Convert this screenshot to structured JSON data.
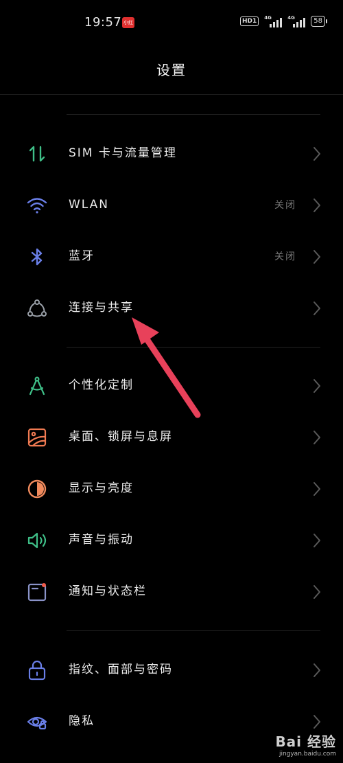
{
  "status_bar": {
    "time": "19:57",
    "app_badge": "小红书",
    "hd": "HD1",
    "signal1": "4G",
    "signal2": "4G",
    "battery": "58"
  },
  "header": {
    "title": "设置"
  },
  "items": [
    {
      "label": "SIM 卡与流量管理",
      "value": "",
      "icon": "sim-data-icon",
      "color": "#3fbf88"
    },
    {
      "label": "WLAN",
      "value": "关闭",
      "icon": "wifi-icon",
      "color": "#6a7fe8"
    },
    {
      "label": "蓝牙",
      "value": "关闭",
      "icon": "bluetooth-icon",
      "color": "#6a7fe8"
    },
    {
      "label": "连接与共享",
      "value": "",
      "icon": "connection-share-icon",
      "color": "#9aa0a8"
    },
    {
      "label": "个性化定制",
      "value": "",
      "icon": "compass-icon",
      "color": "#3fbf88"
    },
    {
      "label": "桌面、锁屏与息屏",
      "value": "",
      "icon": "wallpaper-icon",
      "color": "#f07a52"
    },
    {
      "label": "显示与亮度",
      "value": "",
      "icon": "brightness-icon",
      "color": "#f08a5d"
    },
    {
      "label": "声音与振动",
      "value": "",
      "icon": "speaker-icon",
      "color": "#3fbf88"
    },
    {
      "label": "通知与状态栏",
      "value": "",
      "icon": "notification-icon",
      "color": "#8a93c8"
    },
    {
      "label": "指纹、面部与密码",
      "value": "",
      "icon": "lock-icon",
      "color": "#6a7fe8"
    },
    {
      "label": "隐私",
      "value": "",
      "icon": "privacy-eye-icon",
      "color": "#6a7fe8"
    }
  ],
  "watermark": {
    "brand": "Bai 经验",
    "url": "jingyan.baidu.com"
  },
  "colors": {
    "background": "#000000",
    "annotation_arrow": "#e8415a"
  }
}
